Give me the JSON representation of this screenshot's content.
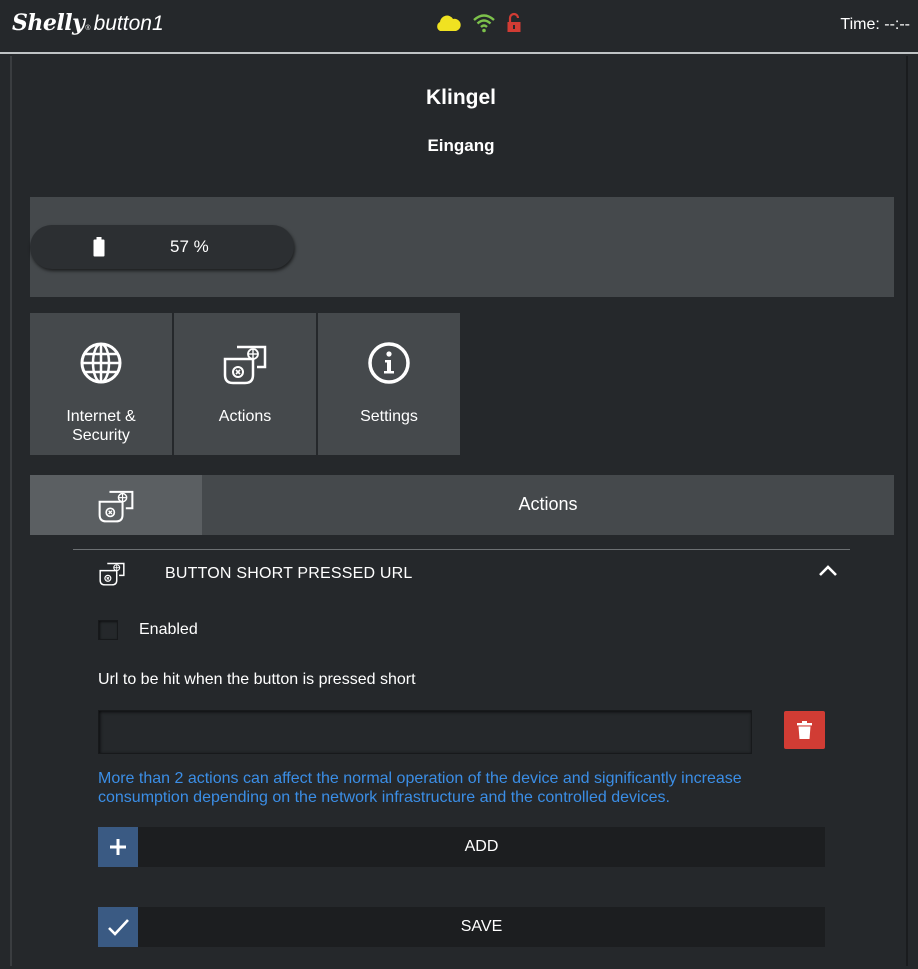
{
  "header": {
    "brand": "Shelly",
    "brand_mark": "®",
    "model": "button1",
    "time_label": "Time: --:--",
    "status_icons": [
      "cloud-icon",
      "wifi-icon",
      "unlocked-icon"
    ],
    "colors": {
      "cloud": "#f0e221",
      "wifi": "#7dc24b",
      "lock": "#d13c34"
    }
  },
  "device": {
    "name": "Klingel",
    "room": "Eingang"
  },
  "battery": {
    "icon": "battery-icon",
    "value": "57 %"
  },
  "tiles": [
    {
      "icon": "globe-icon",
      "label_line1": "Internet &",
      "label_line2": "Security"
    },
    {
      "icon": "actions-icon",
      "label": "Actions"
    },
    {
      "icon": "info-icon",
      "label": "Settings"
    }
  ],
  "section": {
    "icon": "actions-icon",
    "title": "Actions"
  },
  "action_panel": {
    "icon": "actions-icon",
    "title": "BUTTON SHORT PRESSED URL",
    "expanded_icon": "chevron-up-icon",
    "enabled_label": "Enabled",
    "enabled": false,
    "url_label": "Url to be hit when the button is pressed short",
    "url_value": "",
    "url_placeholder": "",
    "delete_icon": "trash-icon",
    "warning": "More than 2 actions can affect the normal operation of the device and significantly increase consumption depending on the network infrastructure and the controlled devices.",
    "add_label": "ADD",
    "save_label": "SAVE"
  },
  "colors": {
    "background": "#25282b",
    "panel": "#45494c",
    "accent_blue": "#3a5a83",
    "warning_text": "#3b8ee6",
    "danger": "#d13c34"
  }
}
